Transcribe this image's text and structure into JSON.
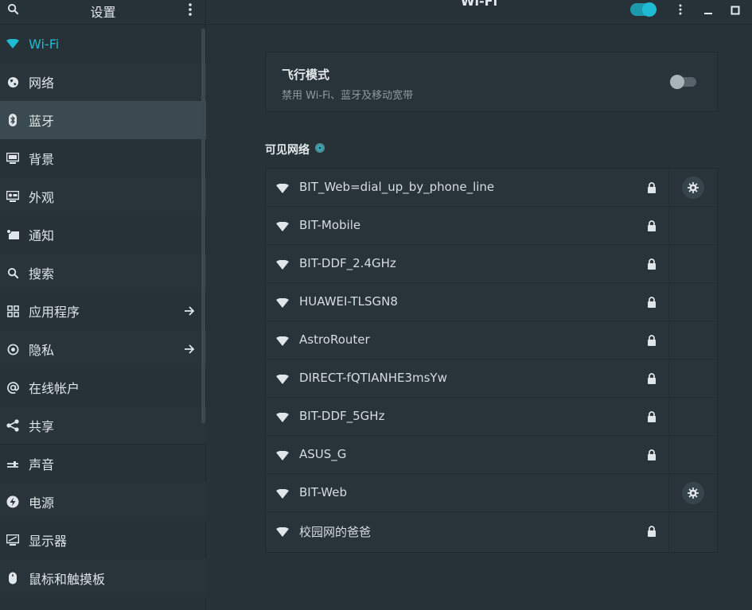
{
  "sidebar": {
    "title": "设置",
    "items": [
      {
        "label": "Wi-Fi",
        "icon": "wifi-icon",
        "active": true
      },
      {
        "label": "网络",
        "icon": "network-globe-icon"
      },
      {
        "label": "蓝牙",
        "icon": "bluetooth-icon",
        "selected": true
      },
      {
        "label": "背景",
        "icon": "background-icon"
      },
      {
        "label": "外观",
        "icon": "appearance-icon"
      },
      {
        "label": "通知",
        "icon": "notification-icon"
      },
      {
        "label": "搜索",
        "icon": "search-icon"
      },
      {
        "label": "应用程序",
        "icon": "apps-grid-icon",
        "arrow": true
      },
      {
        "label": "隐私",
        "icon": "privacy-icon",
        "arrow": true
      },
      {
        "label": "在线帐户",
        "icon": "online-accounts-icon"
      },
      {
        "label": "共享",
        "icon": "share-icon"
      },
      {
        "label": "声音",
        "icon": "sound-icon"
      },
      {
        "label": "电源",
        "icon": "power-icon"
      },
      {
        "label": "显示器",
        "icon": "display-icon"
      },
      {
        "label": "鼠标和触摸板",
        "icon": "mouse-icon"
      }
    ]
  },
  "header": {
    "title": "Wi-Fi",
    "wifi_enabled": true
  },
  "airplane": {
    "title": "飞行模式",
    "subtitle": "禁用 Wi-Fi、蓝牙及移动宽带",
    "enabled": false
  },
  "visible_networks": {
    "label": "可见网络",
    "networks": [
      {
        "ssid": "BIT_Web=dial_up_by_phone_line",
        "locked": true,
        "settings": true
      },
      {
        "ssid": "BIT-Mobile",
        "locked": true
      },
      {
        "ssid": "BIT-DDF_2.4GHz",
        "locked": true
      },
      {
        "ssid": "HUAWEI-TLSGN8",
        "locked": true
      },
      {
        "ssid": "AstroRouter",
        "locked": true
      },
      {
        "ssid": "DIRECT-fQTIANHE3msYw",
        "locked": true
      },
      {
        "ssid": "BIT-DDF_5GHz",
        "locked": true
      },
      {
        "ssid": "ASUS_G",
        "locked": true
      },
      {
        "ssid": "BIT-Web",
        "locked": false,
        "settings": true
      },
      {
        "ssid": "校园网的爸爸",
        "locked": true
      }
    ]
  },
  "colors": {
    "accent": "#1fbbd3",
    "background": "#263238",
    "selected_row": "#3b4a51"
  }
}
